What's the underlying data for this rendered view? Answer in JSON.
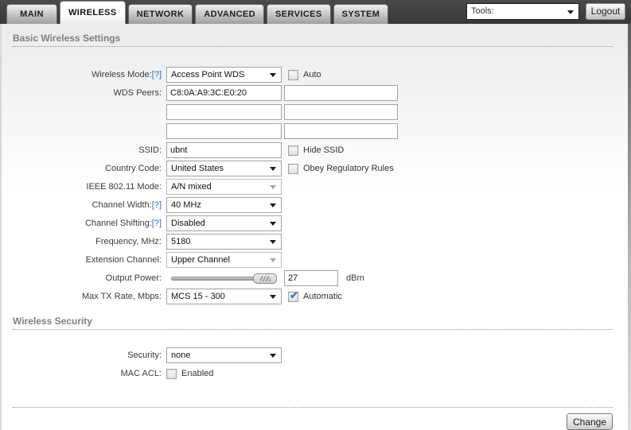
{
  "header": {
    "tabs": [
      {
        "label": "MAIN",
        "active": false
      },
      {
        "label": "WIRELESS",
        "active": true
      },
      {
        "label": "NETWORK",
        "active": false
      },
      {
        "label": "ADVANCED",
        "active": false
      },
      {
        "label": "SERVICES",
        "active": false
      },
      {
        "label": "SYSTEM",
        "active": false
      }
    ],
    "tools_select": {
      "value": "Tools:"
    },
    "logout_button": "Logout"
  },
  "basic_section": {
    "title": "Basic Wireless Settings",
    "wireless_mode": {
      "label": "Wireless Mode:",
      "help": "[?]",
      "value": "Access Point WDS",
      "auto": {
        "label": "Auto",
        "checked": false
      }
    },
    "wds_peers": {
      "label": "WDS Peers:",
      "values": [
        "C8:0A:A9:3C:E0:20",
        "",
        "",
        "",
        "",
        ""
      ]
    },
    "ssid": {
      "label": "SSID:",
      "value": "ubnt",
      "hide": {
        "label": "Hide SSID",
        "checked": false
      }
    },
    "country_code": {
      "label": "Country Code:",
      "value": "United States",
      "obey": {
        "label": "Obey Regulatory Rules",
        "checked": false
      }
    },
    "ieee_mode": {
      "label": "IEEE 802.11 Mode:",
      "value": "A/N mixed",
      "disabled": true
    },
    "channel_width": {
      "label": "Channel Width:",
      "help": "[?]",
      "value": "40 MHz"
    },
    "channel_shifting": {
      "label": "Channel Shifting:",
      "help": "[?]",
      "value": "Disabled"
    },
    "frequency": {
      "label": "Frequency, MHz:",
      "value": "5180"
    },
    "extension_channel": {
      "label": "Extension Channel:",
      "value": "Upper Channel",
      "disabled": true
    },
    "output_power": {
      "label": "Output Power:",
      "value": "27",
      "unit": "dBm",
      "slider_percent": 100
    },
    "max_tx_rate": {
      "label": "Max TX Rate, Mbps:",
      "value": "MCS 15 - 300",
      "automatic": {
        "label": "Automatic",
        "checked": true
      }
    }
  },
  "security_section": {
    "title": "Wireless Security",
    "security": {
      "label": "Security:",
      "value": "none"
    },
    "mac_acl": {
      "label": "MAC ACL:",
      "enabled": {
        "label": "Enabled",
        "checked": false
      }
    }
  },
  "footer": {
    "change_button": "Change"
  },
  "colors": {
    "accent_check_blue": "#3f7cc1",
    "help_link_blue": "#2a72b8",
    "topbar_gray": "#3f3f3f"
  }
}
